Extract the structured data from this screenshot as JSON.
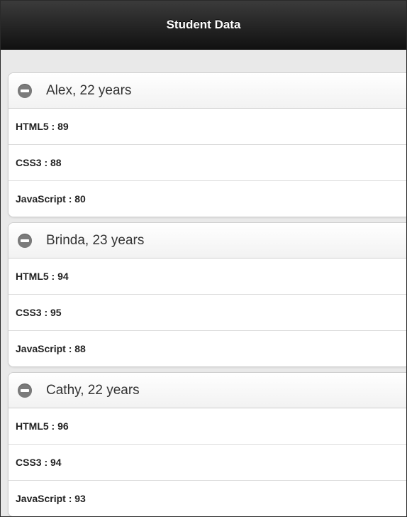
{
  "header": {
    "title": "Student Data"
  },
  "students": [
    {
      "heading": "Alex, 22 years",
      "rows": [
        "HTML5 : 89",
        "CSS3 : 88",
        "JavaScript : 80"
      ]
    },
    {
      "heading": "Brinda, 23 years",
      "rows": [
        "HTML5 : 94",
        "CSS3 : 95",
        "JavaScript : 88"
      ]
    },
    {
      "heading": "Cathy, 22 years",
      "rows": [
        "HTML5 : 96",
        "CSS3 : 94",
        "JavaScript : 93"
      ]
    }
  ],
  "icons": {
    "collapsible": "minus-circle-icon"
  },
  "colors": {
    "header_bg": "#1f1f1f",
    "icon": "#7b7b7b"
  }
}
